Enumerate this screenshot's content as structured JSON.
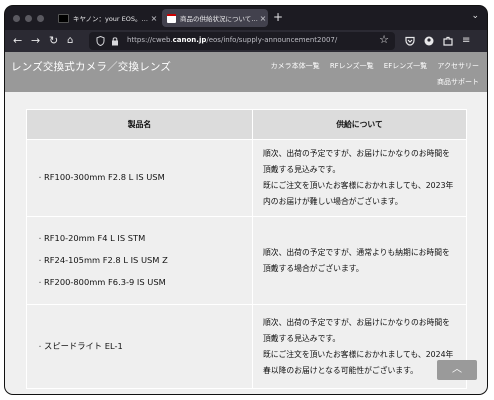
{
  "browser": {
    "tabs": [
      {
        "label": "キヤノン：your EOS。RFレンズ",
        "active": false,
        "favicon_color": "#000000"
      },
      {
        "label": "商品の供給状況についてのお詫び",
        "active": true,
        "favicon_color": "#cc0000"
      }
    ],
    "new_tab": "+",
    "tab_close": "×",
    "tab_list": "⌄",
    "url_prefix": "https://cweb.",
    "url_domain": "canon.jp",
    "url_suffix": "/eos/info/supply-announcement2007/",
    "icons": [
      "back-icon",
      "forward-icon",
      "reload-icon",
      "home-icon",
      "shield-icon",
      "lock-icon",
      "bookmark-star-icon",
      "pocket-icon",
      "account-icon",
      "extensions-icon",
      "menu-icon"
    ]
  },
  "site": {
    "title": "レンズ交換式カメラ／交換レンズ",
    "nav": [
      "カメラ本体一覧",
      "RFレンズ一覧",
      "EFレンズ一覧",
      "アクセサリー",
      "商品サポート"
    ]
  },
  "table": {
    "headers": [
      "製品名",
      "供給について"
    ],
    "rows": [
      {
        "products": [
          "RF100-300mm F2.8 L IS USM"
        ],
        "supply": [
          "順次、出荷の予定ですが、お届けにかなりのお時間を頂戴する見込みです。",
          "既にご注文を頂いたお客様におかれましても、2023年内のお届けが難しい場合がございます。"
        ]
      },
      {
        "products": [
          "RF10-20mm F4 L IS STM",
          "RF24-105mm F2.8 L IS USM Z",
          "RF200-800mm F6.3-9 IS USM"
        ],
        "supply": [
          "順次、出荷の予定ですが、通常よりも納期にお時間を頂戴する場合がございます。"
        ]
      },
      {
        "products": [
          "スピードライト EL-1"
        ],
        "supply": [
          "順次、出荷の予定ですが、お届けにかなりのお時間を頂戴する見込みです。",
          "既にご注文を頂いたお客様におかれましても、2024年春以降のお届けとなる可能性がございます。"
        ]
      }
    ]
  },
  "scroll_top_label": "︿",
  "colors": {
    "header_bg": "#999999",
    "content_bg": "#f0f0f0",
    "th_bg": "#dcdcdc",
    "browser_dark": "#1c1b22"
  }
}
